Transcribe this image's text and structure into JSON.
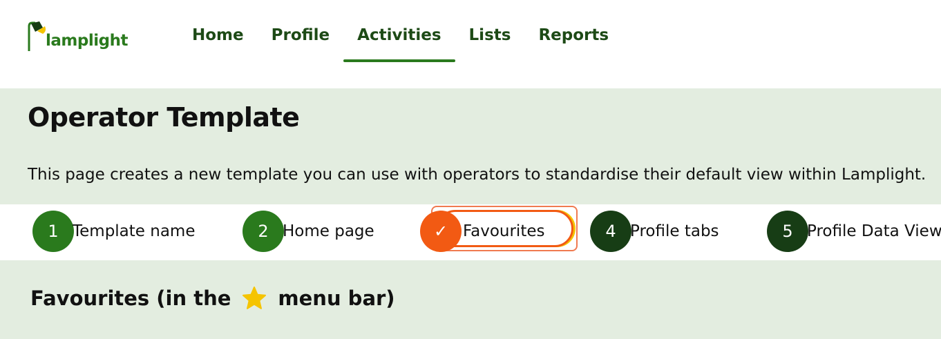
{
  "app": {
    "logo_text": "lamplight"
  },
  "nav": {
    "items": [
      {
        "label": "Home",
        "active": false
      },
      {
        "label": "Profile",
        "active": false
      },
      {
        "label": "Activities",
        "active": true
      },
      {
        "label": "Lists",
        "active": false
      },
      {
        "label": "Reports",
        "active": false
      }
    ]
  },
  "page": {
    "title": "Operator Template",
    "description": "This page creates a new template you can use with operators to standardise their default view within Lamplight."
  },
  "steps": [
    {
      "number": "1",
      "label": "Template name",
      "state": "complete"
    },
    {
      "number": "2",
      "label": "Home page",
      "state": "complete"
    },
    {
      "number": "✓",
      "label": "Favourites",
      "state": "current"
    },
    {
      "number": "4",
      "label": "Profile tabs",
      "state": "pending"
    },
    {
      "number": "5",
      "label": "Profile Data View",
      "state": "pending"
    }
  ],
  "section": {
    "title_prefix": "Favourites (in the",
    "title_suffix": "menu bar)",
    "icon": "star-icon"
  },
  "colors": {
    "brand_green": "#2a7a1d",
    "nav_text": "#1d4a16",
    "band_bg": "#e3ede0",
    "step_dark": "#173d15",
    "step_current": "#f25a13",
    "star": "#f5c400"
  }
}
